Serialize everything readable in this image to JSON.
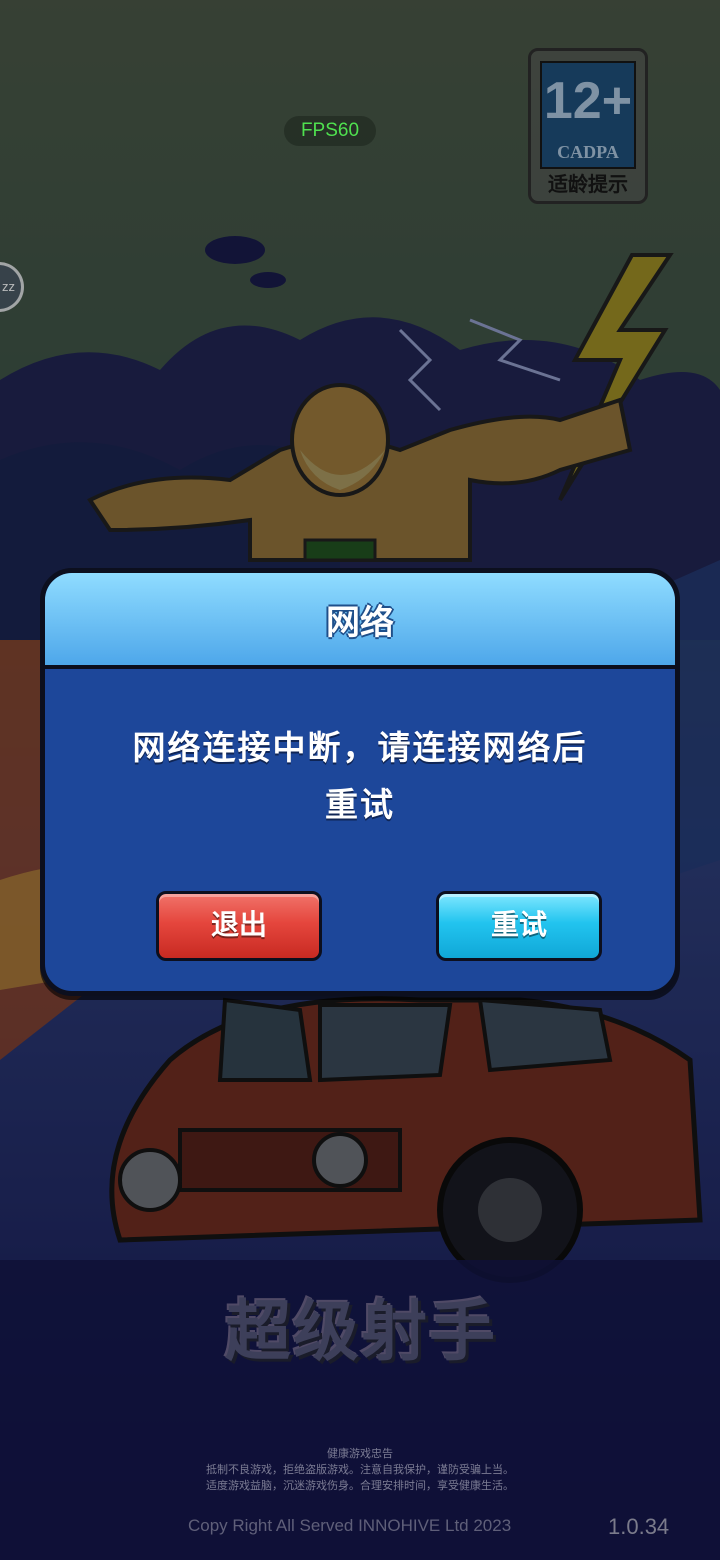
{
  "overlay": {
    "fps": "FPS60",
    "side_bubble": "zz"
  },
  "age_rating": {
    "number": "12+",
    "org": "CADPA",
    "label": "适龄提示"
  },
  "dialog": {
    "title": "网络",
    "message_line1": "网络连接中断，请连接网络后",
    "message_line2": "重试",
    "exit_label": "退出",
    "retry_label": "重试"
  },
  "game": {
    "logo": "超级射手"
  },
  "footer": {
    "health_title": "健康游戏忠告",
    "health_line1": "抵制不良游戏，拒绝盗版游戏。注意自我保护，谨防受骗上当。",
    "health_line2": "适度游戏益脑，沉迷游戏伤身。合理安排时间，享受健康生活。",
    "copyright": "Copy Right All Served INNOHIVE Ltd 2023",
    "version": "1.0.34"
  },
  "colors": {
    "dialog_body": "#1d479a",
    "dialog_header": "#5fb8f0",
    "exit_button": "#e5463d",
    "retry_button": "#22c4ef",
    "fps_text": "#4fe04f"
  }
}
